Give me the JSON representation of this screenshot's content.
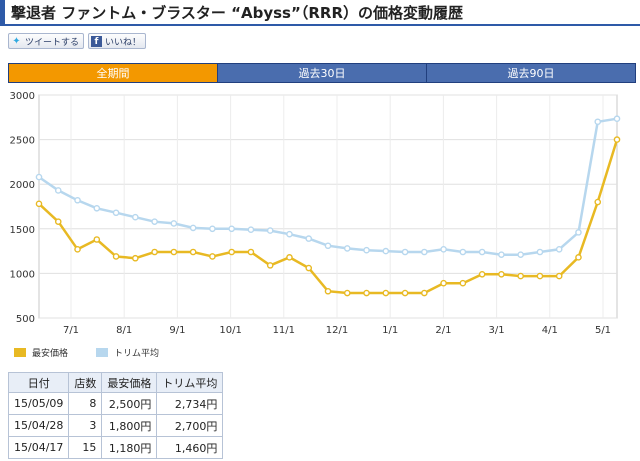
{
  "page": {
    "title": "撃退者 ファントム・ブラスター “Abyss”（RRR）の価格変動履歴"
  },
  "social": {
    "tweet_label": "ツイートする",
    "like_label": "いいね！"
  },
  "tabs": [
    {
      "label": "全期間",
      "active": true
    },
    {
      "label": "過去30日",
      "active": false
    },
    {
      "label": "過去90日",
      "active": false
    }
  ],
  "chart_data": {
    "type": "line",
    "x_tick_labels": [
      "7/1",
      "8/1",
      "9/1",
      "10/1",
      "11/1",
      "12/1",
      "1/1",
      "2/1",
      "3/1",
      "4/1",
      "5/1"
    ],
    "y_ticks": [
      500,
      1000,
      1500,
      2000,
      2500,
      3000
    ],
    "ylim": [
      500,
      3000
    ],
    "grid": true,
    "legend_position": "bottom-left",
    "series": [
      {
        "name": "最安価格",
        "color": "#e8b923",
        "values": [
          1780,
          1580,
          1270,
          1380,
          1190,
          1170,
          1240,
          1240,
          1240,
          1190,
          1240,
          1240,
          1090,
          1180,
          1060,
          800,
          780,
          780,
          780,
          780,
          780,
          890,
          890,
          990,
          990,
          970,
          970,
          970,
          1180,
          1800,
          2500
        ]
      },
      {
        "name": "トリム平均",
        "color": "#b7d7ee",
        "values": [
          2080,
          1930,
          1820,
          1730,
          1680,
          1630,
          1580,
          1560,
          1510,
          1500,
          1500,
          1490,
          1480,
          1440,
          1390,
          1310,
          1280,
          1260,
          1250,
          1240,
          1240,
          1270,
          1240,
          1240,
          1210,
          1210,
          1240,
          1270,
          1460,
          2700,
          2734
        ]
      }
    ]
  },
  "history": {
    "headers": [
      "日付",
      "店数",
      "最安価格",
      "トリム平均"
    ],
    "rows": [
      {
        "date": "15/05/09",
        "shops": "8",
        "min": "2,500円",
        "trim": "2,734円"
      },
      {
        "date": "15/04/28",
        "shops": "3",
        "min": "1,800円",
        "trim": "2,700円"
      },
      {
        "date": "15/04/17",
        "shops": "15",
        "min": "1,180円",
        "trim": "1,460円"
      }
    ]
  }
}
